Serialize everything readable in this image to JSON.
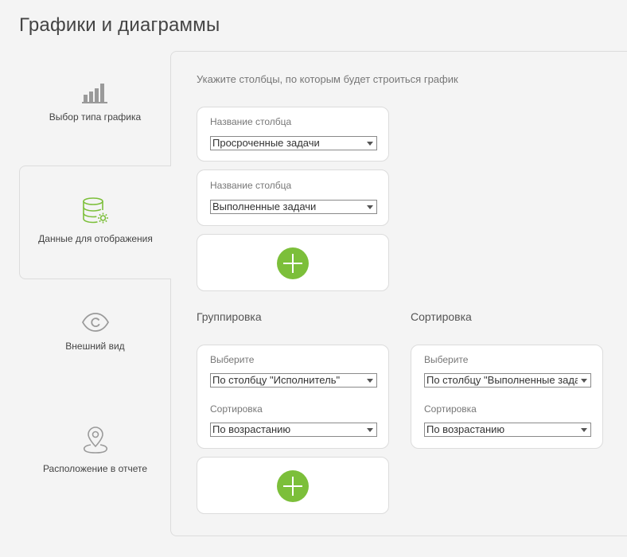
{
  "page": {
    "title": "Графики и диаграммы"
  },
  "sidebar": {
    "steps": [
      {
        "label": "Выбор типа графика",
        "icon": "bar-chart-icon",
        "active": false
      },
      {
        "label": "Данные для отображения",
        "icon": "database-gear-icon",
        "active": true
      },
      {
        "label": "Внешний вид",
        "icon": "eye-icon",
        "active": false
      },
      {
        "label": "Расположение в отчете",
        "icon": "location-pin-icon",
        "active": false
      }
    ]
  },
  "columns": {
    "hint": "Укажите столбцы, по которым будет строиться график",
    "items": [
      {
        "label": "Название столбца",
        "value": "Просроченные задачи"
      },
      {
        "label": "Название столбца",
        "value": "Выполненные задачи"
      }
    ]
  },
  "grouping": {
    "title": "Группировка",
    "select_label": "Выберите",
    "select_value": "По столбцу \"Исполнитель\"",
    "sort_label": "Сортировка",
    "sort_value": "По возрастанию"
  },
  "sorting": {
    "title": "Сортировка",
    "select_label": "Выберите",
    "select_value": "По столбцу \"Выполненные задачи\"",
    "sort_label": "Сортировка",
    "sort_value": "По возрастанию"
  },
  "colors": {
    "accent": "#7cbf3a",
    "icon_gray": "#9a9a9a"
  }
}
